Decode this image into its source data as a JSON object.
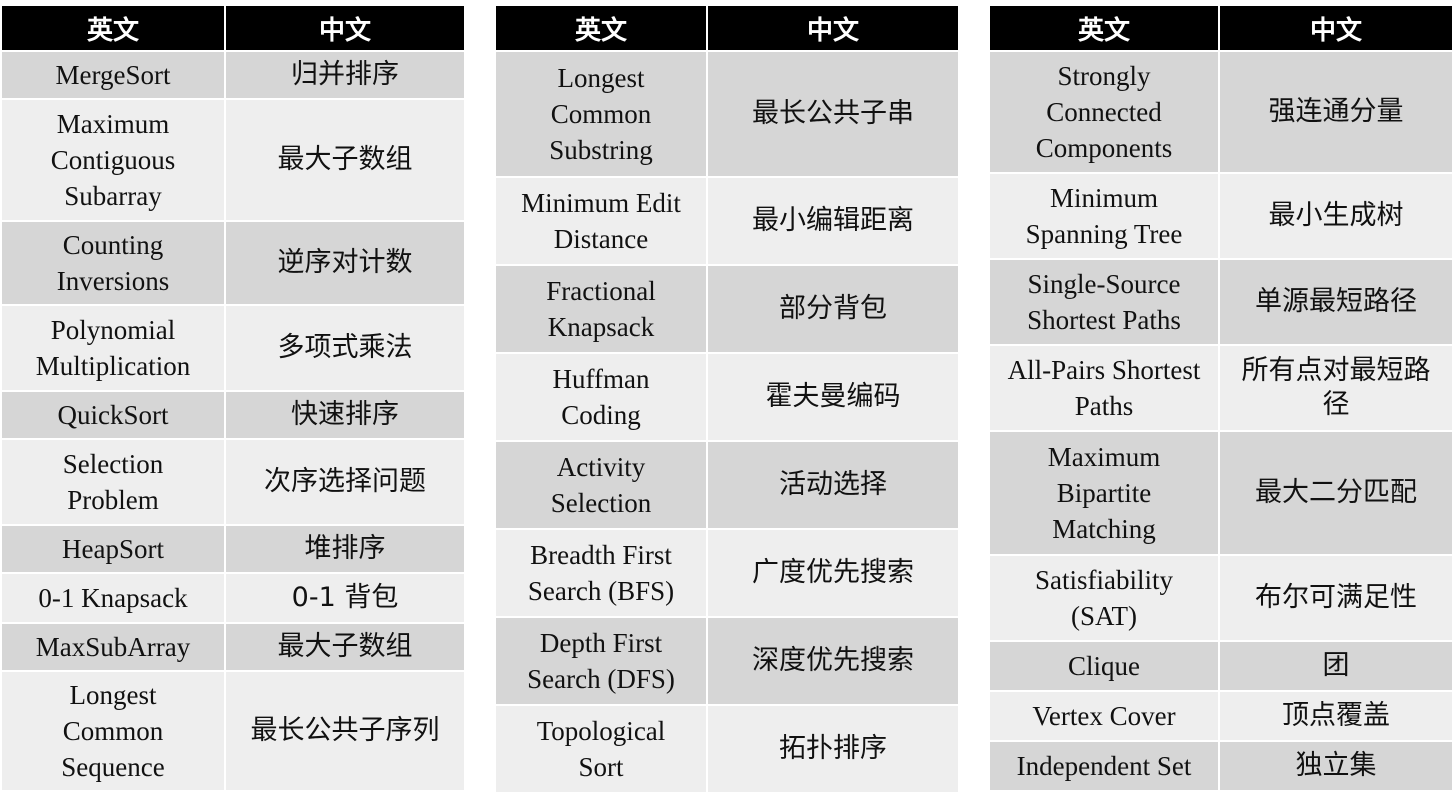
{
  "header": {
    "en": "英文",
    "zh": "中文"
  },
  "tables": [
    [
      {
        "en": "MergeSort",
        "zh": "归并排序"
      },
      {
        "en": "Maximum Contiguous Subarray",
        "zh": "最大子数组"
      },
      {
        "en": "Counting Inversions",
        "zh": "逆序对计数"
      },
      {
        "en": "Polynomial Multiplication",
        "zh": "多项式乘法"
      },
      {
        "en": "QuickSort",
        "zh": "快速排序"
      },
      {
        "en": "Selection Problem",
        "zh": "次序选择问题"
      },
      {
        "en": "HeapSort",
        "zh": "堆排序"
      },
      {
        "en": "0-1 Knapsack",
        "zh": "0-1 背包"
      },
      {
        "en": "MaxSubArray",
        "zh": "最大子数组"
      },
      {
        "en": "Longest Common Sequence",
        "zh": "最长公共子序列"
      }
    ],
    [
      {
        "en": "Longest Common Substring",
        "zh": "最长公共子串"
      },
      {
        "en": "Minimum Edit Distance",
        "zh": "最小编辑距离"
      },
      {
        "en": "Fractional Knapsack",
        "zh": "部分背包"
      },
      {
        "en": "Huffman Coding",
        "zh": "霍夫曼编码"
      },
      {
        "en": "Activity Selection",
        "zh": "活动选择"
      },
      {
        "en": "Breadth First Search (BFS)",
        "zh": "广度优先搜索"
      },
      {
        "en": "Depth First Search (DFS)",
        "zh": "深度优先搜索"
      },
      {
        "en": "Topological Sort",
        "zh": "拓扑排序"
      }
    ],
    [
      {
        "en": "Strongly Connected Components",
        "zh": "强连通分量"
      },
      {
        "en": "Minimum Spanning Tree",
        "zh": "最小生成树"
      },
      {
        "en": "Single-Source Shortest Paths",
        "zh": "单源最短路径"
      },
      {
        "en": "All-Pairs Shortest Paths",
        "zh": "所有点对最短路径"
      },
      {
        "en": "Maximum Bipartite Matching",
        "zh": "最大二分匹配"
      },
      {
        "en": "Satisfiability (SAT)",
        "zh": "布尔可满足性"
      },
      {
        "en": "Clique",
        "zh": "团"
      },
      {
        "en": "Vertex Cover",
        "zh": "顶点覆盖"
      },
      {
        "en": "Independent Set",
        "zh": "独立集"
      }
    ]
  ]
}
